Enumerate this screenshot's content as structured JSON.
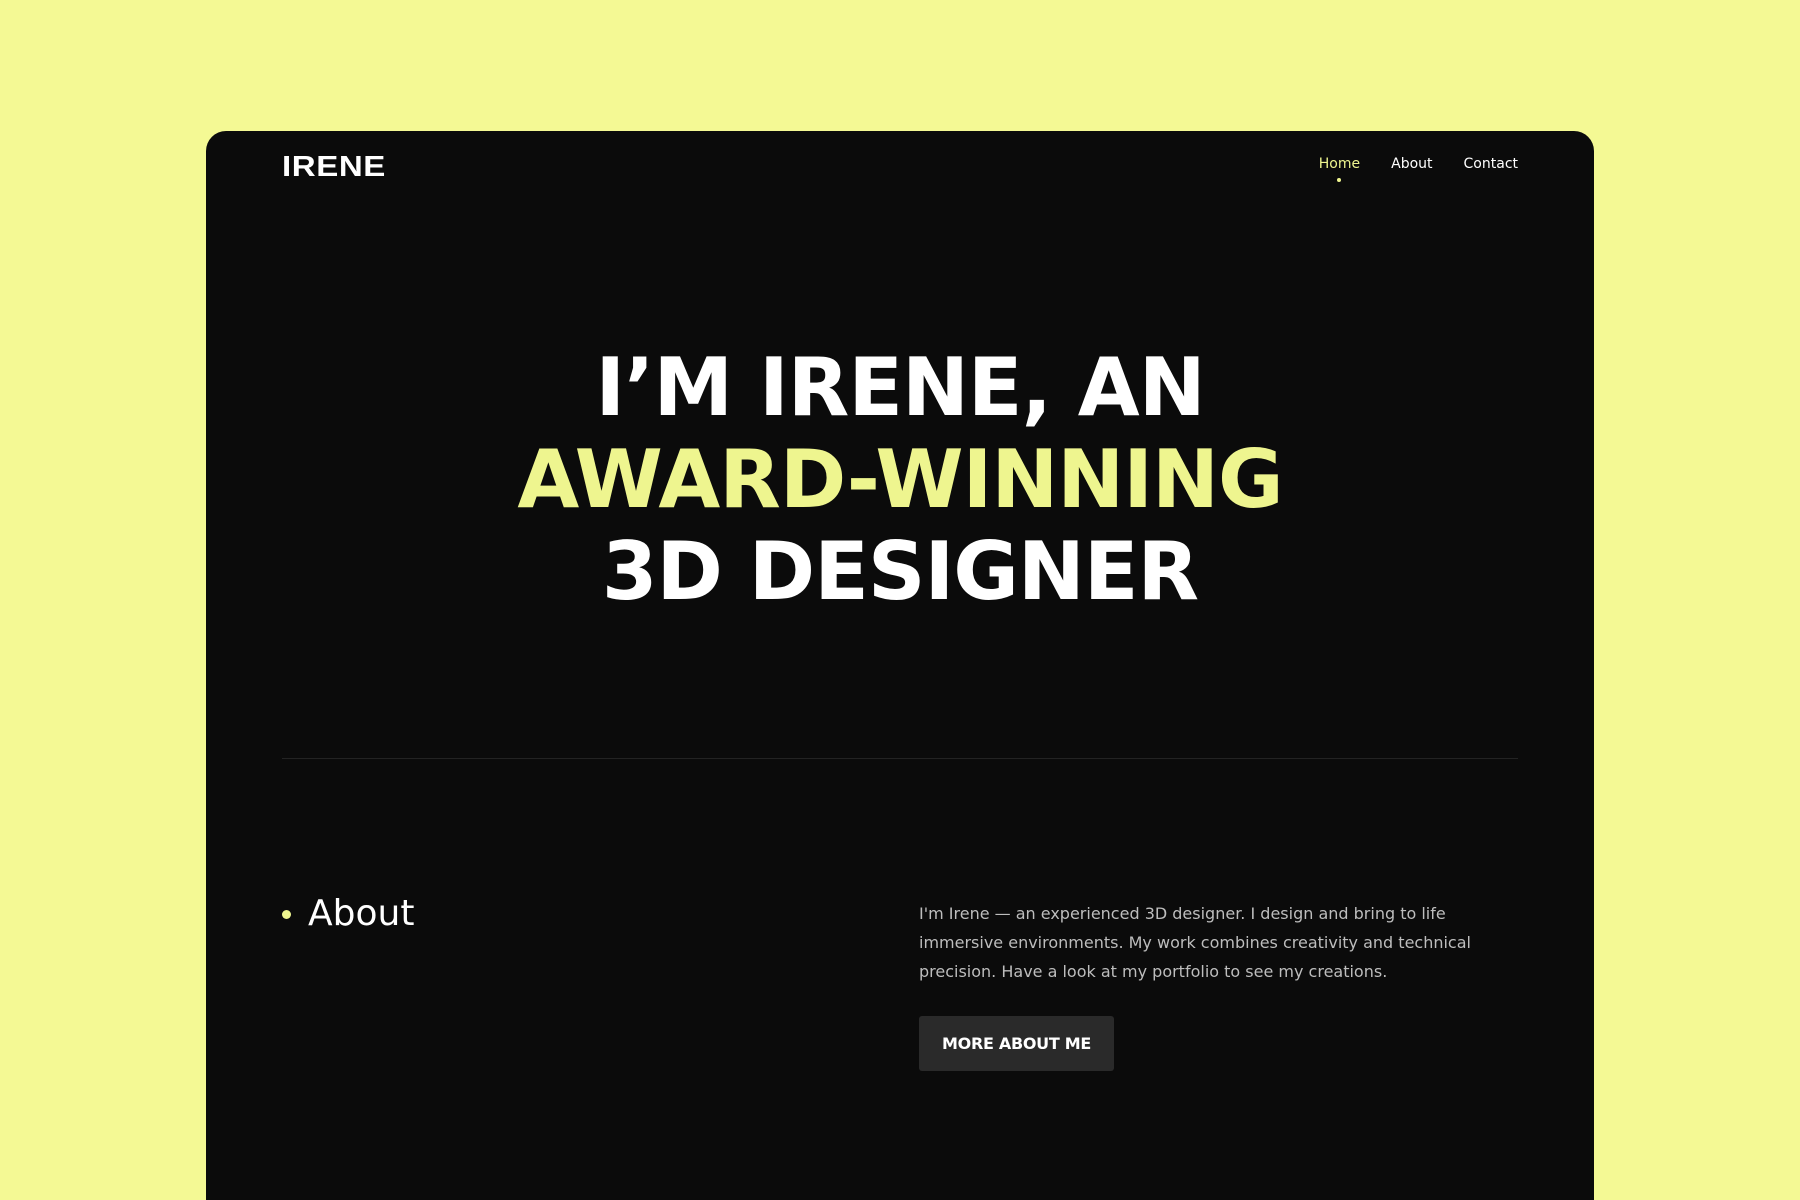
{
  "colors": {
    "background": "#f4f994",
    "card": "#0b0b0b",
    "accent": "#eef58f",
    "text": "#ffffff",
    "muted_text": "#bdbdbd",
    "button": "#2a2a2a"
  },
  "header": {
    "logo": "IRENE",
    "nav": [
      {
        "label": "Home",
        "active": true
      },
      {
        "label": "About",
        "active": false
      },
      {
        "label": "Contact",
        "active": false
      }
    ]
  },
  "hero": {
    "line1": "I’M IRENE, AN",
    "line2": "AWARD-WINNING",
    "line3": "3D DESIGNER"
  },
  "about": {
    "heading": "About",
    "text": "I'm Irene — an experienced 3D designer. I design and bring to life immersive environments. My work combines creativity and technical precision. Have a look at my portfolio to see my creations.",
    "button_label": "MORE ABOUT ME"
  }
}
